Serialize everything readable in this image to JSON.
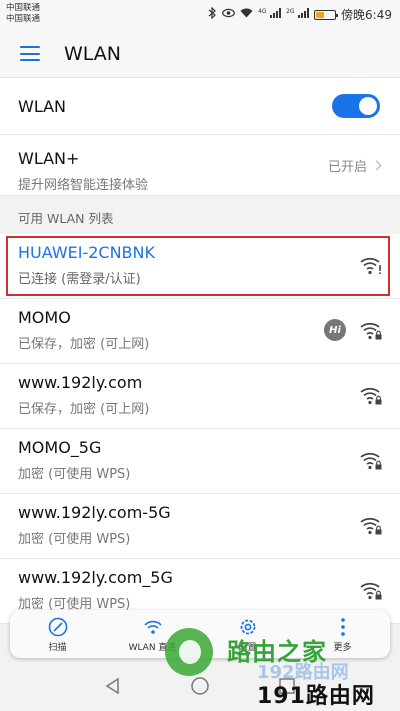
{
  "status_bar": {
    "carrier_1": "中国联通",
    "carrier_2": "中国联通",
    "time": "傍晚6:49",
    "battery_level": 0.45,
    "net_tag_1": "4G",
    "net_tag_2": "2G"
  },
  "app_bar": {
    "title": "WLAN"
  },
  "wlan_toggle": {
    "label": "WLAN",
    "enabled": true,
    "accent": "#1a73e8"
  },
  "wlan_plus": {
    "label": "WLAN+",
    "sub": "提升网络智能连接体验",
    "status": "已开启"
  },
  "section": {
    "title": "可用 WLAN 列表"
  },
  "networks": [
    {
      "ssid": "HUAWEI-2CNBNK",
      "state": "已连接 (需登录/认证)",
      "icon": "wifi-alert-icon",
      "connected": true
    },
    {
      "ssid": "MOMO",
      "state": "已保存，加密 (可上网)",
      "icon": "wifi-lock-icon",
      "badge": "Hi"
    },
    {
      "ssid": "www.192ly.com",
      "state": "已保存，加密 (可上网)",
      "icon": "wifi-lock-icon"
    },
    {
      "ssid": "MOMO_5G",
      "state": "加密 (可使用 WPS)",
      "icon": "wifi-lock-icon"
    },
    {
      "ssid": "www.192ly.com-5G",
      "state": "加密 (可使用 WPS)",
      "icon": "wifi-lock-icon"
    },
    {
      "ssid": "www.192ly.com_5G",
      "state": "加密 (可使用 WPS)",
      "icon": "wifi-lock-icon"
    }
  ],
  "toolbar": {
    "scan_label": "扫描",
    "wlan_direct_label": "WLAN 直连",
    "settings_label": "配置",
    "more_label": "更多"
  },
  "watermark": {
    "cn": "路由之家",
    "url": "192路由网",
    "brand": "191路由网"
  },
  "colors": {
    "highlight_border": "#d32f2f",
    "link_blue": "#1a73e8"
  }
}
